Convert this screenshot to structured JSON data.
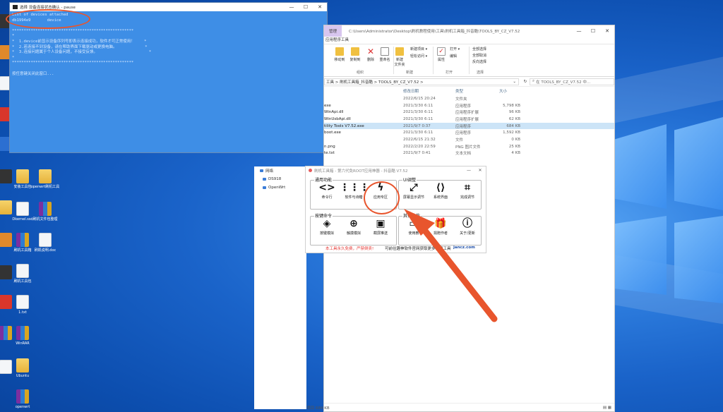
{
  "cmd": {
    "title": "选择 设备连接状态确认 - pause",
    "lines": [
      "List of devices attached",
      "db1994e9       device",
      "",
      "****************************************************",
      "*",
      "*  1.device前显示设备序列号即表示连接成功，软件才可正常使用！    *",
      "*  2.若连接不到设备，请在帮助界面下载驱动或更换电脑。            *",
      "*  3.连接问题属于个人设备问题，不接受反馈。                      *",
      "*",
      "****************************************************",
      "",
      "按任意键关闭此窗口..."
    ]
  },
  "explorer": {
    "manage_tab": "管理",
    "path": "C:\\Users\\Administrator\\Desktop\\刷机教程使用\\工具\\刷机工具箱_抖音酷\\TOOLS_BY_CZ_V7.52",
    "tab": "应用程序工具",
    "ribbon": {
      "buttons": [
        "移动到",
        "复制到",
        "删除",
        "重命名",
        "新建\n文件夹",
        "属性"
      ],
      "small": [
        "新建项目 ▾",
        "轻松访问 ▾",
        "打开 ▾",
        "编辑",
        "全部选择",
        "全部取消",
        "反向选择"
      ],
      "groups": [
        "组织",
        "新建",
        "打开",
        "选择"
      ]
    },
    "breadcrumb": "工具 > 刷机工具箱_抖音酷 > TOOLS_BY_CZ_V7.52 >",
    "search": "在 TOOLS_BY_CZ_V7.52 中...",
    "columns": [
      "修改日期",
      "类型",
      "大小"
    ],
    "rows": [
      {
        "name": "",
        "date": "2022/6/15 20:24",
        "type": "文件夹",
        "size": ""
      },
      {
        "name": "exe",
        "date": "2021/3/30 6:11",
        "type": "应用程序",
        "size": "5,798 KB"
      },
      {
        "name": "WinApi.dll",
        "date": "2021/3/30 6:11",
        "type": "应用程序扩展",
        "size": "96 KB"
      },
      {
        "name": "WinUsbApi.dll",
        "date": "2021/3/30 6:11",
        "type": "应用程序扩展",
        "size": "62 KB"
      },
      {
        "name": "tility Tools V7.52.exe",
        "date": "2021/9/7 0:37",
        "type": "应用程序",
        "size": "684 KB"
      },
      {
        "name": "boot.exe",
        "date": "2021/3/30 6:11",
        "type": "应用程序",
        "size": "1,592 KB"
      },
      {
        "name": "",
        "date": "2022/6/15 21:32",
        "type": "文件",
        "size": "0 KB"
      },
      {
        "name": "n.png",
        "date": "2022/2/20 22:59",
        "type": "PNG 图片文件",
        "size": "25 KB"
      },
      {
        "name": "te.txt",
        "date": "2021/9/7 0:41",
        "type": "文本文档",
        "size": "4 KB"
      }
    ],
    "status_count": "9 个项目",
    "status_sel": "选中 1 个项目  684 KB"
  },
  "sidebar": [
    "网络",
    "DS918",
    "OpenWrt"
  ],
  "tool": {
    "title": "刷机工具箱 - 第六代免ROOT应用神器 - 抖音酷 V7.52",
    "groups": {
      "common": "通用功能",
      "ui": "UI调整",
      "keys": "按键命令",
      "other": "其他功能"
    },
    "buttons": [
      {
        "icon": "<>",
        "label": "命令行"
      },
      {
        "icon": "⋮⋮⋮",
        "label": "软件与诗糖"
      },
      {
        "icon": "ϟ",
        "label": "应用专区"
      },
      {
        "icon": "⤢",
        "label": "屏幕显示调节"
      },
      {
        "icon": "⟨⟩",
        "label": "系统界面"
      },
      {
        "icon": "⌗",
        "label": "完成调节"
      },
      {
        "icon": "◈",
        "label": "按键模拟"
      },
      {
        "icon": "⊕",
        "label": "触摸模拟"
      },
      {
        "icon": "▣",
        "label": "截屏推送"
      },
      {
        "icon": "▭",
        "label": "使用教"
      },
      {
        "icon": "🎁",
        "label": "捐赠作者"
      },
      {
        "icon": "ⓘ",
        "label": "关于/更新"
      }
    ],
    "footer_red": "本工具永久免费，严禁倒卖!",
    "footer_black": "可前往趣神软件官网获取更多优质工具",
    "footer_site": "jancz.com"
  },
  "desktop_icons": [
    "安装工具包",
    "openwrt刷机工具",
    "Dkernel.ssd",
    "刷机文件包整理",
    "刷机工具箱",
    "刷机说明.doc",
    "刷机工具包",
    "1.txt",
    "Lucky Patcher",
    "WinRAR",
    "APKTool",
    "Ubuntu",
    "openwrt"
  ],
  "colors": {
    "accent": "#e8552d",
    "cmd_bg": "#3e8ee6",
    "desktop": "#1a63c9"
  }
}
